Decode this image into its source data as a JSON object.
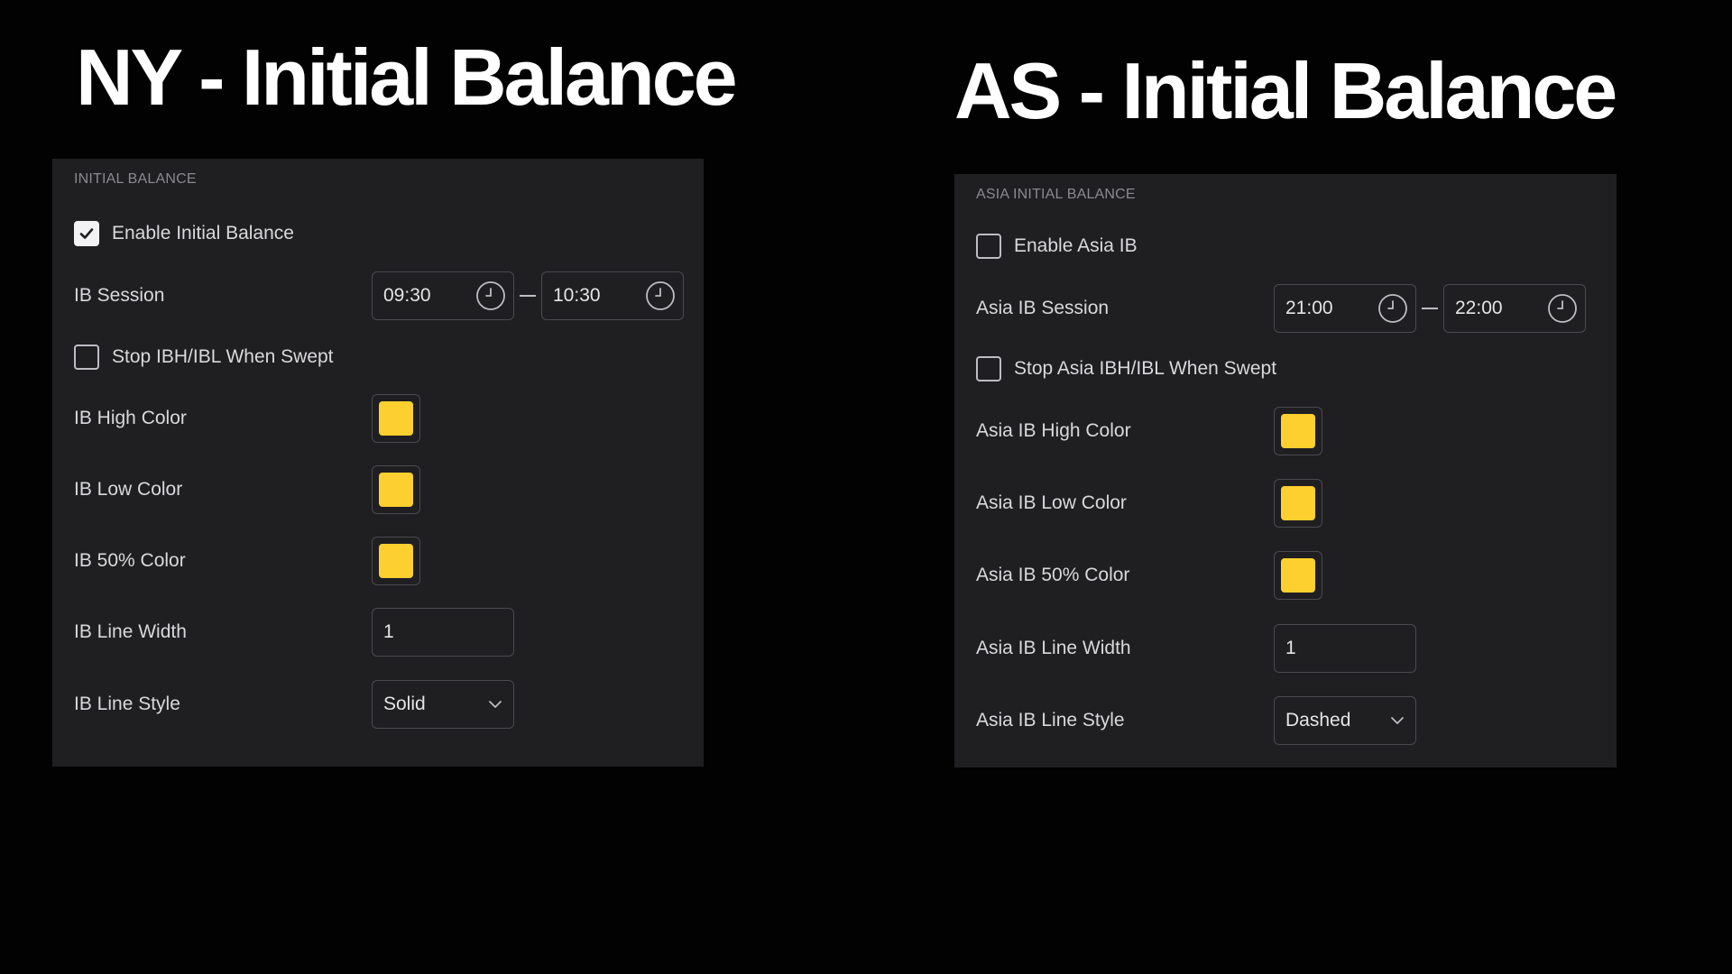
{
  "colors": {
    "background": "#020203",
    "panel": "#1f1f22",
    "swatch_yellow": "#fdd02f"
  },
  "ny": {
    "heading": "NY - Initial Balance",
    "section_title": "INITIAL BALANCE",
    "enable_label": "Enable Initial Balance",
    "enable_checked": true,
    "session_label": "IB Session",
    "session_start": "09:30",
    "session_end": "10:30",
    "stop_label": "Stop IBH/IBL When Swept",
    "stop_checked": false,
    "high_color_label": "IB High Color",
    "low_color_label": "IB Low Color",
    "mid_color_label": "IB 50% Color",
    "line_width_label": "IB Line Width",
    "line_width_value": "1",
    "line_style_label": "IB Line Style",
    "line_style_value": "Solid"
  },
  "as": {
    "heading": "AS - Initial Balance",
    "section_title": "ASIA INITIAL BALANCE",
    "enable_label": "Enable Asia IB",
    "enable_checked": false,
    "session_label": "Asia IB Session",
    "session_start": "21:00",
    "session_end": "22:00",
    "stop_label": "Stop Asia IBH/IBL When Swept",
    "stop_checked": false,
    "high_color_label": "Asia IB High Color",
    "low_color_label": "Asia IB Low Color",
    "mid_color_label": "Asia IB 50% Color",
    "line_width_label": "Asia IB Line Width",
    "line_width_value": "1",
    "line_style_label": "Asia IB Line Style",
    "line_style_value": "Dashed"
  }
}
